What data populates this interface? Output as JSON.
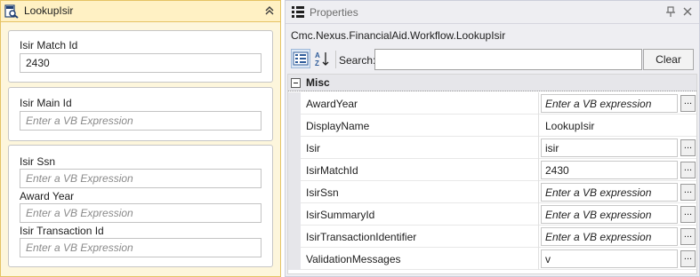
{
  "activity": {
    "title": "LookupIsir",
    "icon": "search-document-icon",
    "fields": {
      "isir_match_id": {
        "label": "Isir Match Id",
        "value": "2430"
      },
      "isir_main_id": {
        "label": "Isir Main Id",
        "placeholder": "Enter a VB Expression"
      },
      "isir_ssn": {
        "label": "Isir Ssn",
        "placeholder": "Enter a VB Expression"
      },
      "award_year": {
        "label": "Award Year",
        "placeholder": "Enter a VB Expression"
      },
      "isir_transaction_id": {
        "label": "Isir Transaction Id",
        "placeholder": "Enter a VB Expression"
      }
    }
  },
  "properties": {
    "title": "Properties",
    "selected_object": "Cmc.Nexus.FinancialAid.Workflow.LookupIsir",
    "search_label": "Search:",
    "search_value": "",
    "clear_label": "Clear",
    "category": "Misc",
    "ellipsis_label": "...",
    "rows": [
      {
        "name": "AwardYear",
        "value": "Enter a VB expression",
        "placeholder": true,
        "editable": true
      },
      {
        "name": "DisplayName",
        "value": "LookupIsir",
        "placeholder": false,
        "editable": false
      },
      {
        "name": "Isir",
        "value": "isir",
        "placeholder": false,
        "editable": true
      },
      {
        "name": "IsirMatchId",
        "value": "2430",
        "placeholder": false,
        "editable": true
      },
      {
        "name": "IsirSsn",
        "value": "Enter a VB expression",
        "placeholder": true,
        "editable": true
      },
      {
        "name": "IsirSummaryId",
        "value": "Enter a VB expression",
        "placeholder": true,
        "editable": true
      },
      {
        "name": "IsirTransactionIdentifier",
        "value": "Enter a VB expression",
        "placeholder": true,
        "editable": true
      },
      {
        "name": "ValidationMessages",
        "value": "v",
        "placeholder": false,
        "editable": true
      }
    ]
  },
  "colors": {
    "activity_background": "#fdf6dc",
    "activity_border": "#e5c365",
    "panel_background": "#eeeef2",
    "placeholder_text": "#8a8a8a"
  }
}
